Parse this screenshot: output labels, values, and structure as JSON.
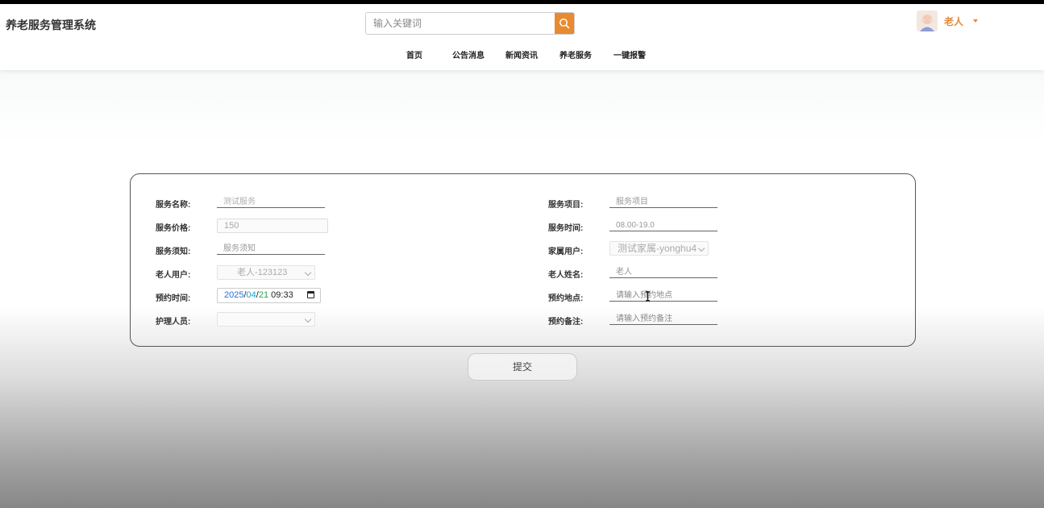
{
  "app_title": "养老服务管理系统",
  "search": {
    "placeholder": "输入关键词"
  },
  "user": {
    "name": "老人"
  },
  "nav": [
    "首页",
    "公告消息",
    "新闻资讯",
    "养老服务",
    "一键报警"
  ],
  "form": {
    "left": [
      {
        "label": "服务名称:",
        "value": "测试服务"
      },
      {
        "label": "服务价格:",
        "value": "150"
      },
      {
        "label": "服务须知:",
        "placeholder": "服务须知"
      },
      {
        "label": "老人用户:",
        "value": "老人-123123"
      },
      {
        "label": "预约时间:",
        "year": "2025",
        "month": "04",
        "day": "21",
        "time": "09:33"
      },
      {
        "label": "护理人员:",
        "value": ""
      }
    ],
    "right": [
      {
        "label": "服务项目:",
        "placeholder": "服务项目"
      },
      {
        "label": "服务时间:",
        "value": "08.00-19.0"
      },
      {
        "label": "家属用户:",
        "value": "测试家属-yonghu4"
      },
      {
        "label": "老人姓名:",
        "value": "老人"
      },
      {
        "label": "预约地点:",
        "placeholder": "请输入预约地点"
      },
      {
        "label": "预约备注:",
        "placeholder": "请输入预约备注"
      }
    ],
    "submit_label": "提交"
  },
  "colors": {
    "accent": "#e98a2f",
    "user_name": "#e5893a"
  }
}
